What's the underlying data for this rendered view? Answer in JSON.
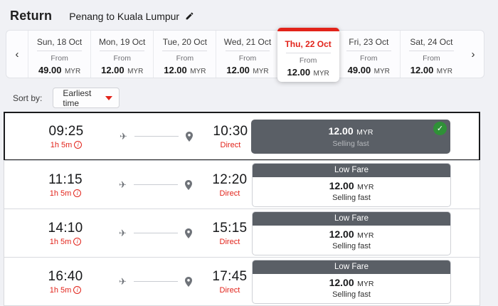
{
  "header": {
    "title": "Return",
    "route": "Penang to Kuala Lumpur"
  },
  "date_carousel": {
    "from_label": "From",
    "days": [
      {
        "date": "Sun, 18 Oct",
        "price": "49.00",
        "currency": "MYR",
        "selected": false
      },
      {
        "date": "Mon, 19 Oct",
        "price": "12.00",
        "currency": "MYR",
        "selected": false
      },
      {
        "date": "Tue, 20 Oct",
        "price": "12.00",
        "currency": "MYR",
        "selected": false
      },
      {
        "date": "Wed, 21 Oct",
        "price": "12.00",
        "currency": "MYR",
        "selected": false
      },
      {
        "date": "Thu, 22 Oct",
        "price": "12.00",
        "currency": "MYR",
        "selected": true
      },
      {
        "date": "Fri, 23 Oct",
        "price": "49.00",
        "currency": "MYR",
        "selected": false
      },
      {
        "date": "Sat, 24 Oct",
        "price": "12.00",
        "currency": "MYR",
        "selected": false
      }
    ]
  },
  "sort": {
    "label": "Sort by:",
    "selected_option": "Earliest time"
  },
  "fare_labels": {
    "low_fare": "Low Fare",
    "selling_fast": "Selling fast"
  },
  "flights": [
    {
      "dep": "09:25",
      "duration": "1h 5m",
      "arr": "10:30",
      "stops": "Direct",
      "price": "12.00",
      "currency": "MYR",
      "note": "Selling fast",
      "selected": true
    },
    {
      "dep": "11:15",
      "duration": "1h 5m",
      "arr": "12:20",
      "stops": "Direct",
      "price": "12.00",
      "currency": "MYR",
      "note": "Selling fast",
      "selected": false
    },
    {
      "dep": "14:10",
      "duration": "1h 5m",
      "arr": "15:15",
      "stops": "Direct",
      "price": "12.00",
      "currency": "MYR",
      "note": "Selling fast",
      "selected": false
    },
    {
      "dep": "16:40",
      "duration": "1h 5m",
      "arr": "17:45",
      "stops": "Direct",
      "price": "12.00",
      "currency": "MYR",
      "note": "Selling fast",
      "selected": false
    }
  ],
  "icons": {
    "prev": "‹",
    "next": "›",
    "plane": "✈",
    "check": "✓",
    "info": "i"
  },
  "colors": {
    "accent_red": "#e2231a",
    "fare_dark": "#5a5f66",
    "check_green": "#2f9137",
    "page_bg": "#f0f1f5"
  }
}
